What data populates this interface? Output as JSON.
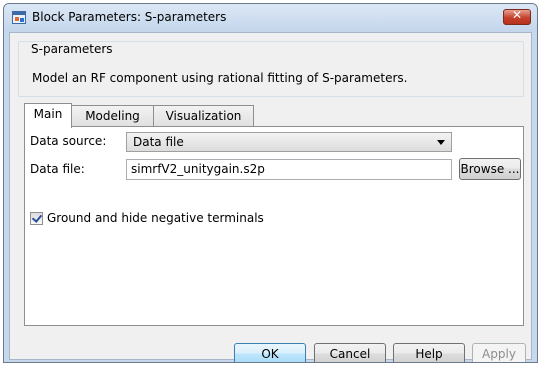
{
  "window": {
    "title": "Block Parameters: S-parameters",
    "close_glyph": "✕"
  },
  "block": {
    "name": "S-parameters",
    "description": "Model an RF component using rational fitting of S-parameters."
  },
  "tabs": [
    {
      "label": "Main",
      "active": true
    },
    {
      "label": "Modeling",
      "active": false
    },
    {
      "label": "Visualization",
      "active": false
    }
  ],
  "main": {
    "data_source_label": "Data source:",
    "data_source_value": "Data file",
    "data_file_label": "Data file:",
    "data_file_value": "simrfV2_unitygain.s2p",
    "browse_label": "Browse ...",
    "ground_checkbox_label": "Ground and hide negative terminals",
    "ground_checked": true
  },
  "buttons": {
    "ok": "OK",
    "cancel": "Cancel",
    "help": "Help",
    "apply": "Apply"
  },
  "colors": {
    "frame": "#c7d8ec",
    "client": "#f0f0f0",
    "close_button": "#c4412c",
    "ok_border": "#3c7fb1"
  },
  "icons": {
    "app": "simulink-block-icon",
    "dropdown": "chevron-down-icon",
    "checkbox": "checkmark-icon"
  }
}
